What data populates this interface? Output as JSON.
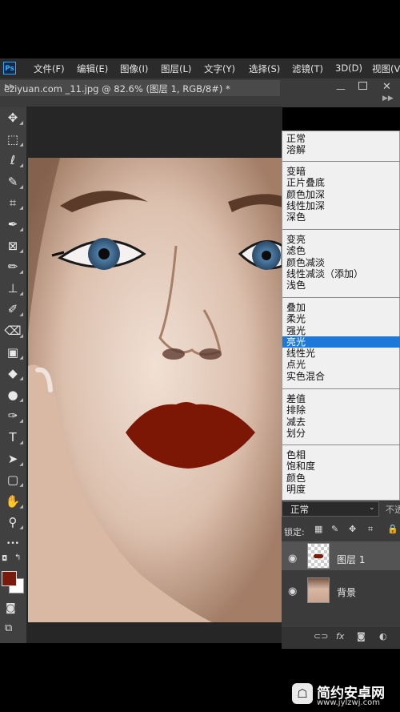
{
  "app": {
    "logo": "Ps"
  },
  "menu": [
    "文件(F)",
    "编辑(E)",
    "图像(I)",
    "图层(L)",
    "文字(Y)",
    "选择(S)",
    "滤镜(T)",
    "3D(D)",
    "视图(V"
  ],
  "document": {
    "tab_title": "eziyuan.com _11.jpg @ 82.6% (图层 1, RGB/8#) *",
    "window_controls": {
      "minimize": "—",
      "close": "✕"
    }
  },
  "tools": [
    {
      "name": "move-tool",
      "icon": "move-icon",
      "glyph": "✥"
    },
    {
      "name": "marquee-tool",
      "icon": "marquee-icon",
      "glyph": "⬚"
    },
    {
      "name": "lasso-tool",
      "icon": "lasso-icon",
      "glyph": "ℓ"
    },
    {
      "name": "quick-select-tool",
      "icon": "quick-select-icon",
      "glyph": "✎"
    },
    {
      "name": "crop-tool",
      "icon": "crop-icon",
      "glyph": "⌗"
    },
    {
      "name": "eyedropper-tool",
      "icon": "eyedropper-icon",
      "glyph": "✒"
    },
    {
      "name": "frame-tool",
      "icon": "frame-icon",
      "glyph": "⊠"
    },
    {
      "name": "brush-tool",
      "icon": "brush-icon",
      "glyph": "✏"
    },
    {
      "name": "stamp-tool",
      "icon": "stamp-icon",
      "glyph": "⊥"
    },
    {
      "name": "history-brush-tool",
      "icon": "history-brush-icon",
      "glyph": "✐"
    },
    {
      "name": "eraser-tool",
      "icon": "eraser-icon",
      "glyph": "⌫"
    },
    {
      "name": "gradient-tool",
      "icon": "gradient-icon",
      "glyph": "▣"
    },
    {
      "name": "blur-tool",
      "icon": "blur-icon",
      "glyph": "◆"
    },
    {
      "name": "dodge-tool",
      "icon": "dodge-icon",
      "glyph": "●"
    },
    {
      "name": "pen-tool",
      "icon": "pen-icon",
      "glyph": "✑"
    },
    {
      "name": "type-tool",
      "icon": "type-icon",
      "glyph": "T"
    },
    {
      "name": "path-select-tool",
      "icon": "path-select-icon",
      "glyph": "➤"
    },
    {
      "name": "shape-tool",
      "icon": "rectangle-icon",
      "glyph": "▢"
    },
    {
      "name": "hand-tool",
      "icon": "hand-icon",
      "glyph": "✋"
    },
    {
      "name": "zoom-tool",
      "icon": "zoom-icon",
      "glyph": "⚲"
    },
    {
      "name": "more-tools",
      "icon": "ellipsis-icon",
      "glyph": "•••"
    }
  ],
  "colors": {
    "foreground": "#7a1a0c",
    "background": "#ffffff",
    "lips": "#7c1605",
    "highlight": "#1e78d8"
  },
  "blend_modes": [
    [
      "正常",
      "溶解"
    ],
    [
      "变暗",
      "正片叠底",
      "颜色加深",
      "线性加深",
      "深色"
    ],
    [
      "变亮",
      "滤色",
      "颜色减淡",
      "线性减淡（添加）",
      "浅色"
    ],
    [
      "叠加",
      "柔光",
      "强光",
      "亮光",
      "线性光",
      "点光",
      "实色混合"
    ],
    [
      "差值",
      "排除",
      "减去",
      "划分"
    ],
    [
      "色相",
      "饱和度",
      "颜色",
      "明度"
    ]
  ],
  "blend_highlighted": "亮光",
  "layers_panel": {
    "blend_value": "正常",
    "opacity_label": "不透",
    "lock_label": "锁定:",
    "layers": [
      {
        "name": "图层 1",
        "selected": true
      },
      {
        "name": "背景",
        "selected": false
      }
    ]
  },
  "watermark": {
    "title": "简约安卓网",
    "url": "www.jylzwj.com"
  }
}
